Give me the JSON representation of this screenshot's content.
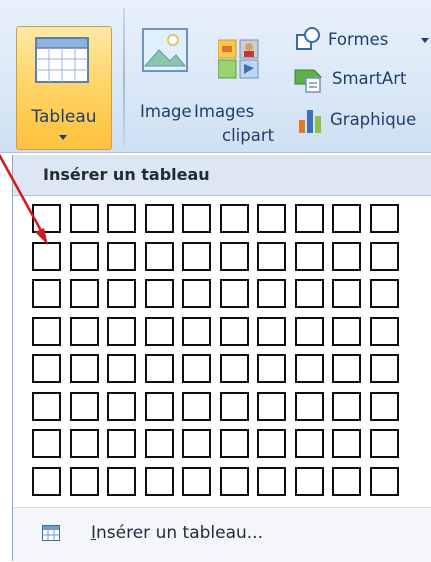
{
  "ribbon": {
    "table_button_label": "Tableau",
    "image_label": "Image",
    "clipart_label_1": "Images",
    "clipart_label_2": "clipart",
    "shapes_label": "Formes",
    "smartart_label": "SmartArt",
    "chart_label": "Graphique"
  },
  "panel": {
    "title": "Insérer un tableau",
    "grid_columns": 10,
    "grid_rows": 8,
    "footer_label_u": "I",
    "footer_label_rest": "nsérer un tableau..."
  },
  "colors": {
    "accent_arrow": "#d11b1b",
    "selected_button": "#ffd56a",
    "header_bg": "#dde7f3"
  },
  "icons": [
    "table-icon",
    "image-icon",
    "clipart-icon",
    "shapes-icon",
    "smartart-icon",
    "chart-icon",
    "insert-table-icon",
    "annotation-arrow"
  ]
}
